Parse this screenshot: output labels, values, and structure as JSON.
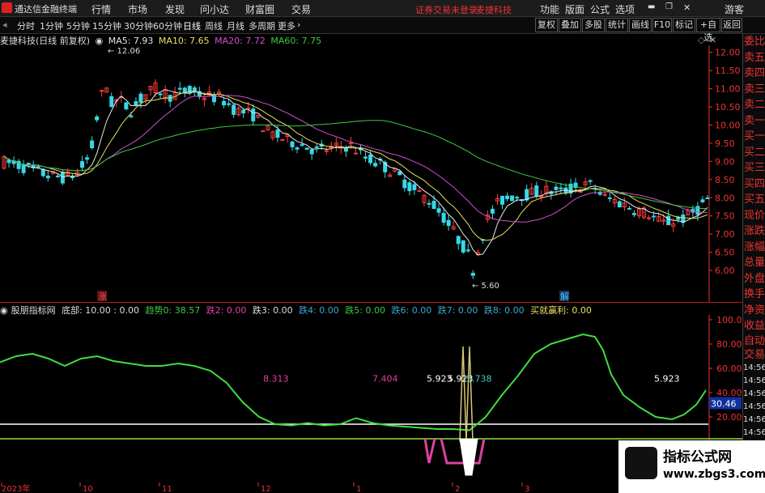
{
  "menu": {
    "app_title": "通达信金融终端",
    "items": [
      "行情",
      "市场",
      "发现",
      "问小达",
      "财富圈",
      "交易"
    ],
    "notice_login": "证券交易未登录",
    "notice_stock": "麦捷科技",
    "right": [
      "功能",
      "版面",
      "公式",
      "选项"
    ],
    "guest": "游客"
  },
  "toolbar": {
    "periods": [
      "分时",
      "1分钟",
      "5分钟",
      "15分钟",
      "30分钟",
      "60分钟",
      "日线",
      "周线",
      "月线",
      "多周期",
      "更多"
    ],
    "active_period": "日线",
    "buttons": [
      "复权",
      "叠加",
      "多股",
      "统计",
      "画线",
      "F10",
      "标记",
      "+自选",
      "返回"
    ]
  },
  "main_chart": {
    "stock_label": "麦捷科技(日线 前复权)",
    "ma5": "MA5: 7.93",
    "ma10": "MA10: 7.65",
    "ma20": "MA20: 7.72",
    "ma60": "MA60: 7.75",
    "high_label": "12.06",
    "low_label": "5.60",
    "mark_up": "涨",
    "mark_down": "解",
    "y_ticks": [
      "12.00",
      "11.50",
      "11.00",
      "10.50",
      "10.00",
      "9.50",
      "9.00",
      "8.50",
      "8.00",
      "7.50",
      "7.00",
      "6.50",
      "6.00"
    ],
    "colors": {
      "up": "#ff3b3b",
      "down": "#38d8e8",
      "ma5": "#e8e8e8",
      "ma10": "#e8e060",
      "ma20": "#d050d0",
      "ma60": "#40c840",
      "axis": "#e33"
    }
  },
  "indicator": {
    "name": "股朋指标网",
    "bottom": "底部: 10.00 : 0.00",
    "trend": "趋势0: 38.57",
    "d2": "跌2: 0.00",
    "d3": "跌3: 0.00",
    "d4": "跌4: 0.00",
    "d5": "跌5: 0.00",
    "d6": "跌6: 0.00",
    "d7": "跌7: 0.00",
    "d8": "跌8: 0.00",
    "buy": "买就赢利: 0.00",
    "labels": [
      "8.313",
      "7.404",
      "5.923",
      "5.923",
      "5.738",
      "5.923"
    ],
    "y_ticks": [
      "100.0",
      "80.00",
      "60.00",
      "40.00",
      "20.00"
    ],
    "current_value": "30.46"
  },
  "x_axis": [
    "2023年",
    "10",
    "11",
    "12",
    "1",
    "2",
    "3"
  ],
  "side_panel": {
    "items": [
      "委比",
      "卖五",
      "卖四",
      "卖三",
      "卖二",
      "卖一",
      "买一",
      "买二",
      "买三",
      "买四",
      "买五",
      "现价",
      "涨跌",
      "涨幅",
      "总量",
      "外盘",
      "换手",
      "净资",
      "收益"
    ],
    "sub_title": "自动交易",
    "times": [
      "14:56",
      "14:56",
      "14:56",
      "14:56",
      "14:56",
      "14:56",
      "14:56",
      "14:56"
    ]
  },
  "watermark": {
    "line1": "指标公式网",
    "line2": "www.zbgs3.com"
  }
}
